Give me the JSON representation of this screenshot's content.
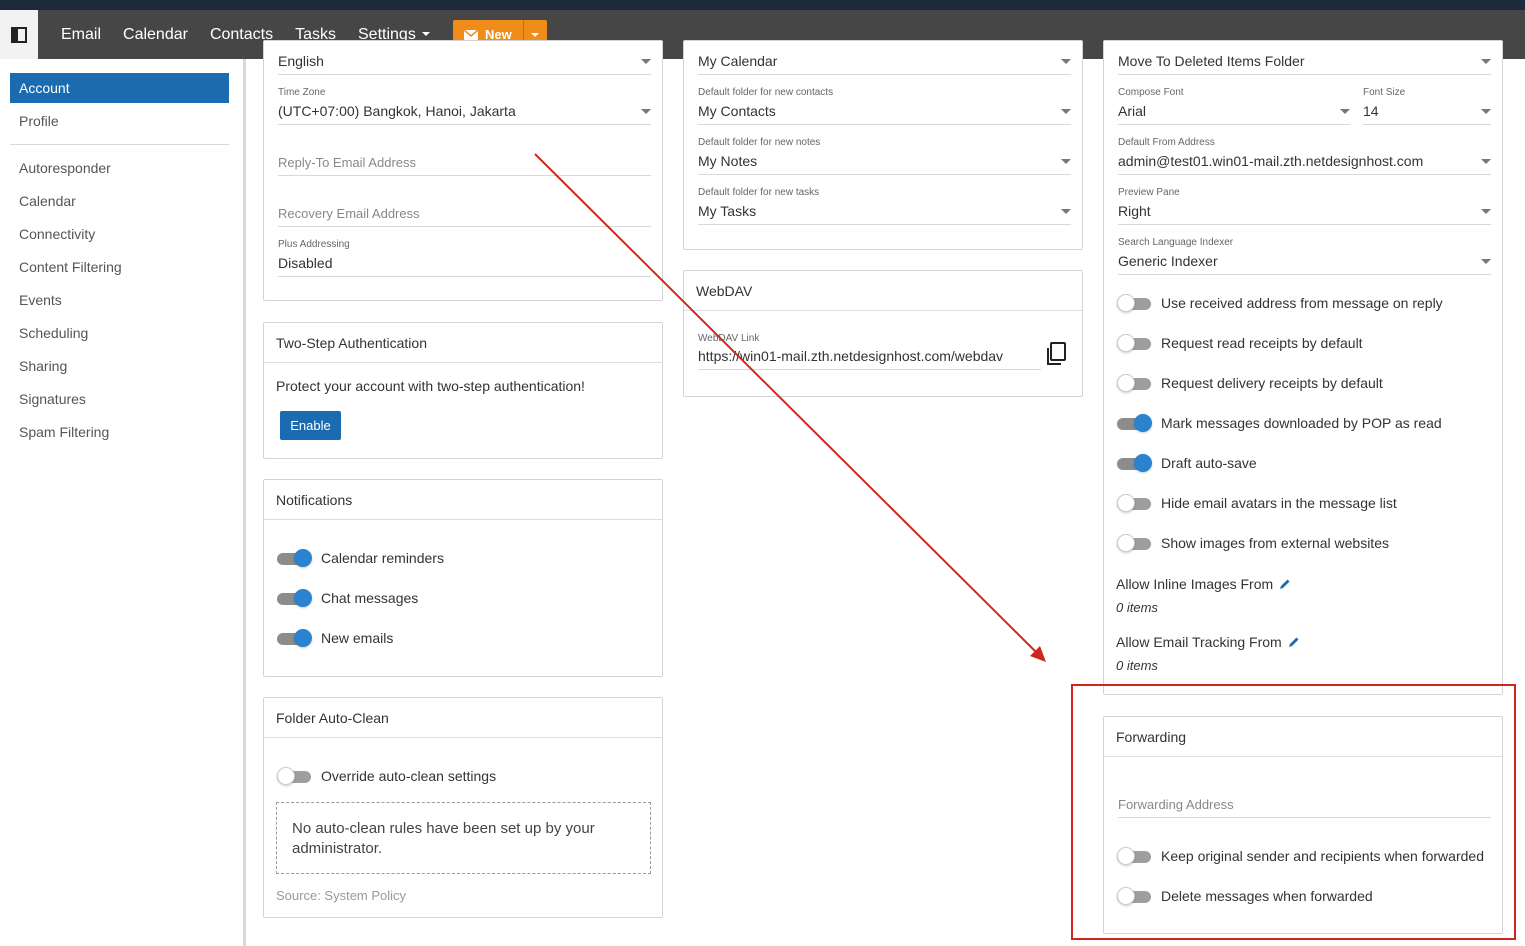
{
  "nav": {
    "items": [
      "Email",
      "Calendar",
      "Contacts",
      "Tasks",
      "Settings"
    ],
    "new_label": "New",
    "accent": "#f08d1a"
  },
  "sidebar": {
    "items": [
      "Account",
      "Profile",
      "Autoresponder",
      "Calendar",
      "Connectivity",
      "Content Filtering",
      "Events",
      "Scheduling",
      "Sharing",
      "Signatures",
      "Spam Filtering"
    ],
    "active": "Account"
  },
  "col1": {
    "language": "English",
    "timezone_label": "Time Zone",
    "timezone": "(UTC+07:00) Bangkok, Hanoi, Jakarta",
    "reply_to_placeholder": "Reply-To Email Address",
    "recovery_placeholder": "Recovery Email Address",
    "plus_label": "Plus Addressing",
    "plus_value": "Disabled",
    "two_step": {
      "title": "Two-Step Authentication",
      "text": "Protect your account with two-step authentication!",
      "button": "Enable"
    },
    "notifications": {
      "title": "Notifications",
      "items": [
        {
          "label": "Calendar reminders",
          "on": true
        },
        {
          "label": "Chat messages",
          "on": true
        },
        {
          "label": "New emails",
          "on": true
        }
      ]
    },
    "autoclean": {
      "title": "Folder Auto-Clean",
      "toggle": "Override auto-clean settings",
      "note": "No auto-clean rules have been set up by your administrator.",
      "source": "Source: System Policy"
    }
  },
  "col2": {
    "calendar_value": "My Calendar",
    "contacts_label": "Default folder for new contacts",
    "contacts_value": "My Contacts",
    "notes_label": "Default folder for new notes",
    "notes_value": "My Notes",
    "tasks_label": "Default folder for new tasks",
    "tasks_value": "My Tasks",
    "webdav": {
      "title": "WebDAV",
      "link_label": "WebDAV Link",
      "link": "https://win01-mail.zth.netdesignhost.com/webdav"
    }
  },
  "col3": {
    "deleted_value": "Move To Deleted Items Folder",
    "font_label": "Compose Font",
    "font_value": "Arial",
    "size_label": "Font Size",
    "size_value": "14",
    "from_label": "Default From Address",
    "from_value": "admin@test01.win01-mail.zth.netdesignhost.com",
    "preview_label": "Preview Pane",
    "preview_value": "Right",
    "indexer_label": "Search Language Indexer",
    "indexer_value": "Generic Indexer",
    "toggles": [
      {
        "label": "Use received address from message on reply",
        "on": false
      },
      {
        "label": "Request read receipts by default",
        "on": false
      },
      {
        "label": "Request delivery receipts by default",
        "on": false
      },
      {
        "label": "Mark messages downloaded by POP as read",
        "on": true
      },
      {
        "label": "Draft auto-save",
        "on": true
      },
      {
        "label": "Hide email avatars in the message list",
        "on": false
      },
      {
        "label": "Show images from external websites",
        "on": false
      }
    ],
    "inline_images_title": "Allow Inline Images From",
    "inline_images_count": "0 items",
    "tracking_title": "Allow Email Tracking From",
    "tracking_count": "0 items",
    "forwarding": {
      "title": "Forwarding",
      "address_placeholder": "Forwarding Address",
      "keep_label": "Keep original sender and recipients when forwarded",
      "delete_label": "Delete messages when forwarded"
    }
  },
  "annotation_color": "#d0271d"
}
